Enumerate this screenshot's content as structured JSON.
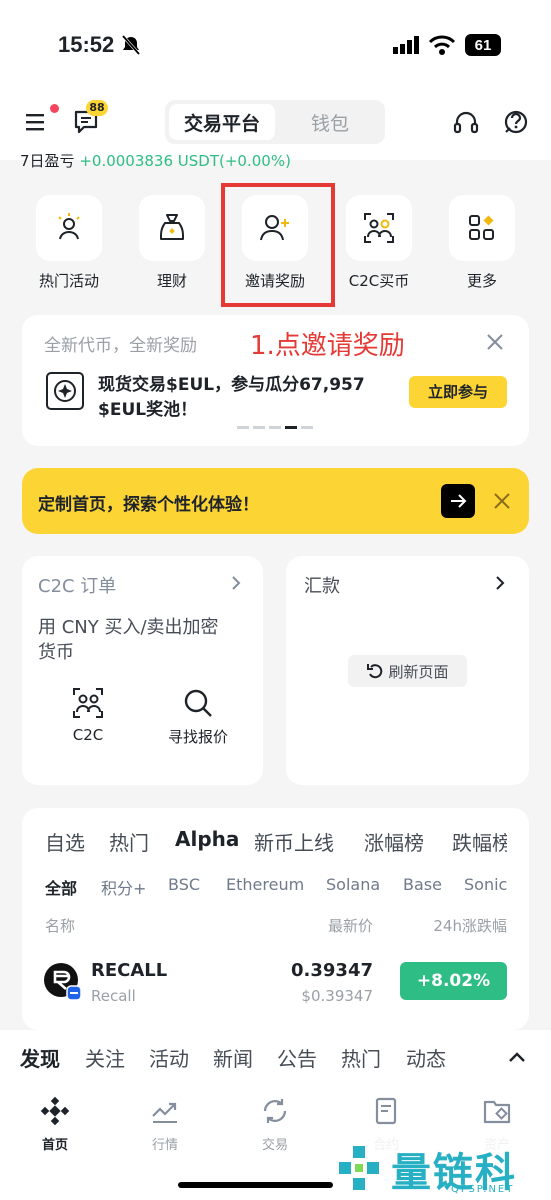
{
  "status": {
    "time": "15:52",
    "battery": "61"
  },
  "header": {
    "badge": "88",
    "tab_exchange": "交易平台",
    "tab_wallet": "钱包",
    "clipped_prefix": "7日盈亏",
    "clipped_value": "+0.0003836 USDT(+0.00%)"
  },
  "quick_actions": [
    {
      "label": "热门活动",
      "icon": "hot-activity-icon"
    },
    {
      "label": "理财",
      "icon": "money-bag-icon"
    },
    {
      "label": "邀请奖励",
      "icon": "invite-user-icon"
    },
    {
      "label": "C2C买币",
      "icon": "c2c-users-icon"
    },
    {
      "label": "更多",
      "icon": "more-grid-icon"
    }
  ],
  "notice": {
    "title": "全新代币，全新奖励",
    "annotation": "1.点邀请奖励",
    "body_line1": "现货交易$EUL，参与瓜分67,957",
    "body_line2": "$EUL奖池！",
    "cta": "立即参与"
  },
  "custom_banner": {
    "text": "定制首页，探索个性化体验！"
  },
  "c2c_card": {
    "title": "C2C 订单",
    "desc_line1": "用 CNY 买入/卖出加密",
    "desc_line2": "货币",
    "action1": "C2C",
    "action2": "寻找报价"
  },
  "remit_card": {
    "title": "汇款",
    "refresh": "刷新页面"
  },
  "market": {
    "tabs": [
      "自选",
      "热门",
      "Alpha",
      "新币上线",
      "涨幅榜",
      "跌幅榜"
    ],
    "filters": [
      "全部",
      "积分+",
      "BSC",
      "Ethereum",
      "Solana",
      "Base",
      "Sonic"
    ],
    "col_name": "名称",
    "col_price": "最新价",
    "col_change": "24h涨跌幅",
    "row": {
      "symbol": "RECALL",
      "name": "Recall",
      "price": "0.39347",
      "price_usd": "$0.39347",
      "change": "+8.02%"
    }
  },
  "discover": {
    "tabs": [
      "发现",
      "关注",
      "活动",
      "新闻",
      "公告",
      "热门",
      "动态"
    ]
  },
  "tabbar": [
    "首页",
    "行情",
    "交易",
    "合约",
    "资产"
  ],
  "watermark": {
    "name": "量链科技",
    "url": "QFSP.NET"
  },
  "colors": {
    "brand_yellow": "#FCD535",
    "up_green": "#2EBD85",
    "annotation_red": "#E53935"
  }
}
